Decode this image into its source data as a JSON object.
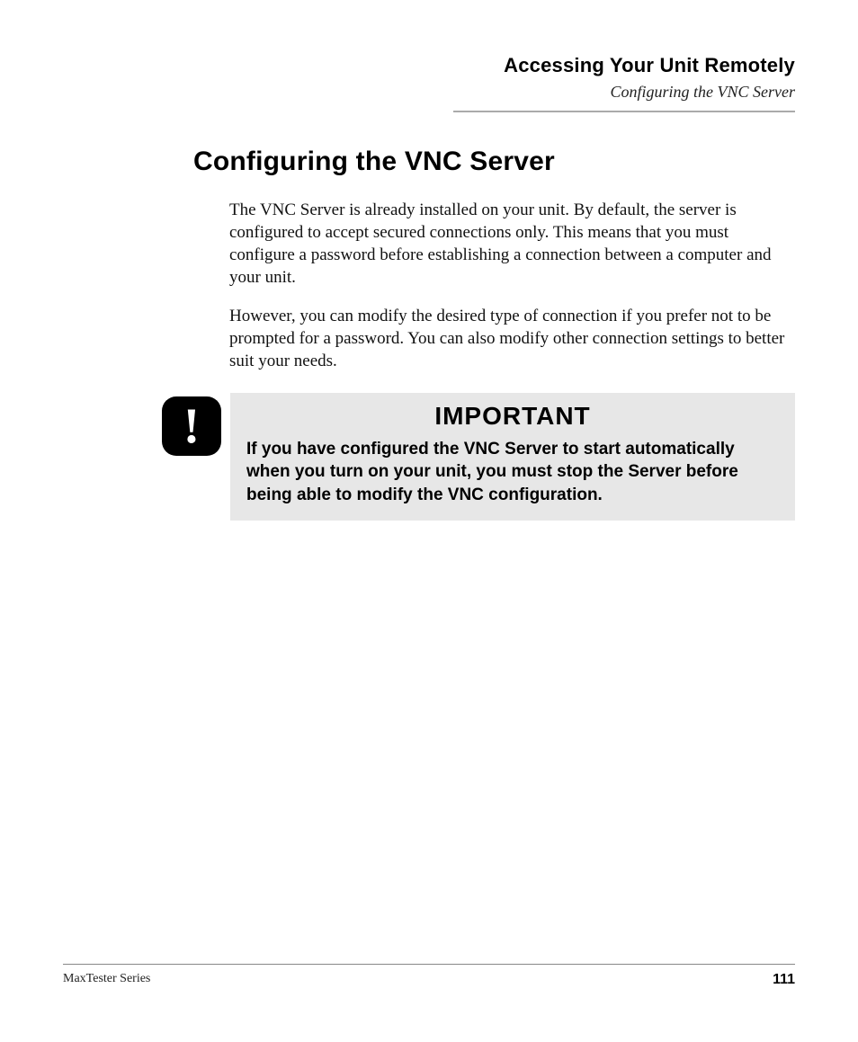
{
  "header": {
    "chapter": "Accessing Your Unit Remotely",
    "section": "Configuring the VNC Server"
  },
  "heading": "Configuring the VNC Server",
  "paragraphs": [
    "The VNC Server is already installed on your unit. By default, the server is configured to accept secured connections only. This means that you must configure a password before establishing a connection between a computer and your unit.",
    "However, you can modify the desired type of connection if you prefer not to be prompted for a password. You can also modify other connection settings to better suit your needs."
  ],
  "important": {
    "icon_glyph": "!",
    "title": "IMPORTANT",
    "text": "If you have configured the VNC Server to start automatically when you turn on your unit, you must stop the Server before being able to modify the VNC configuration."
  },
  "footer": {
    "series": "MaxTester Series",
    "page_number": "111"
  }
}
